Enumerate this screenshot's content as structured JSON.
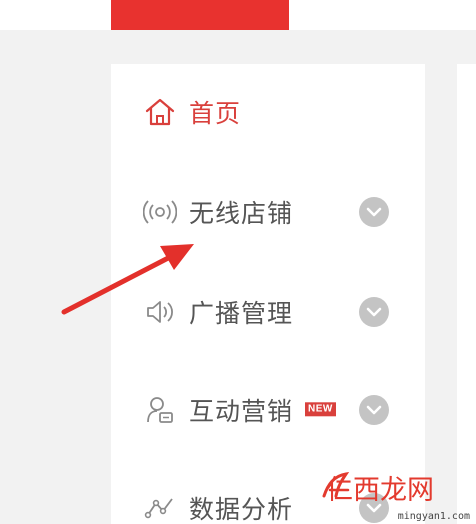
{
  "nav": {
    "items": [
      {
        "label": "首页",
        "icon": "home-icon",
        "active": true,
        "has_chevron": false
      },
      {
        "label": "无线店铺",
        "icon": "wireless-signal-icon",
        "active": false,
        "has_chevron": true
      },
      {
        "label": "广播管理",
        "icon": "speaker-icon",
        "active": false,
        "has_chevron": true
      },
      {
        "label": "互动营销",
        "icon": "user-message-icon",
        "active": false,
        "has_chevron": true,
        "badge": "NEW"
      },
      {
        "label": "数据分析",
        "icon": "line-chart-icon",
        "active": false,
        "has_chevron": true
      }
    ]
  },
  "watermark": {
    "title": "仁西龙网",
    "subtitle": "mingyan1.com"
  },
  "colors": {
    "accent": "#d9403c",
    "text": "#555555",
    "chevron": "#c4c4c4",
    "background": "#f2f2f2",
    "panel": "#ffffff"
  }
}
